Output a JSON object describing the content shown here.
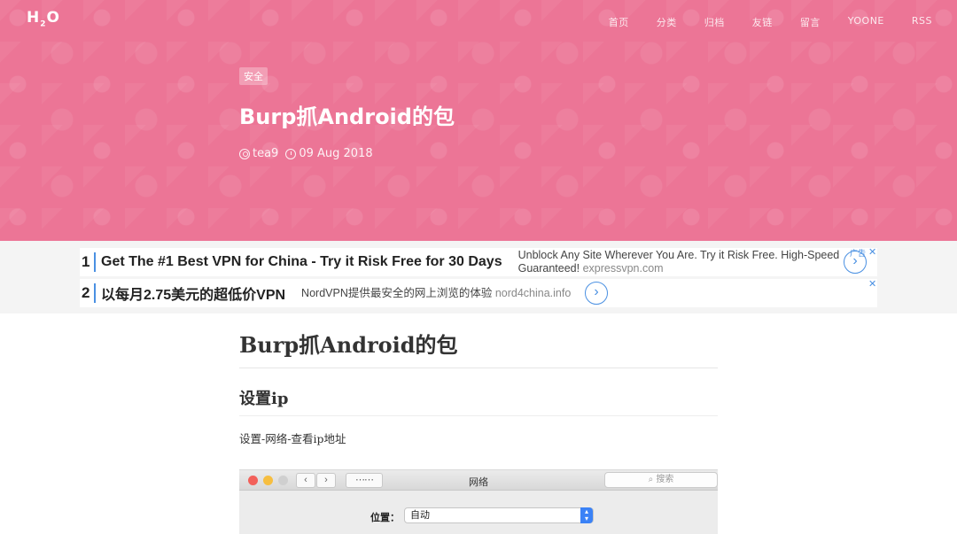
{
  "site": {
    "logo": {
      "main": "H",
      "sub": "2",
      "tail": "O"
    },
    "nav": [
      "首页",
      "分类",
      "归档",
      "友链",
      "留言",
      "YOONE",
      "RSS"
    ]
  },
  "hero": {
    "tag": "安全",
    "title": "Burp抓Android的包",
    "author": "tea9",
    "date": "09 Aug 2018",
    "bg_color": "#ec7596"
  },
  "ads": [
    {
      "number": "1",
      "headline": "Get The #1 Best VPN for China - Try it Risk Free for 30 Days",
      "desc": "Unblock Any Site Wherever You Are. Try it Risk Free. High-Speed Guaranteed!",
      "url": "expressvpn.com",
      "label": "广告"
    },
    {
      "number": "2",
      "headline": "以每月2.75美元的超低价VPN",
      "desc": "NordVPN提供最安全的网上浏览的体验",
      "url": "nord4china.info"
    }
  ],
  "article": {
    "title": "Burp抓Android的包",
    "section1": "设置ip",
    "para1": "设置-网络-查看ip地址"
  },
  "screenshot": {
    "window_title": "网络",
    "search_placeholder": "搜索",
    "location_label": "位置：",
    "location_value": "自动"
  }
}
